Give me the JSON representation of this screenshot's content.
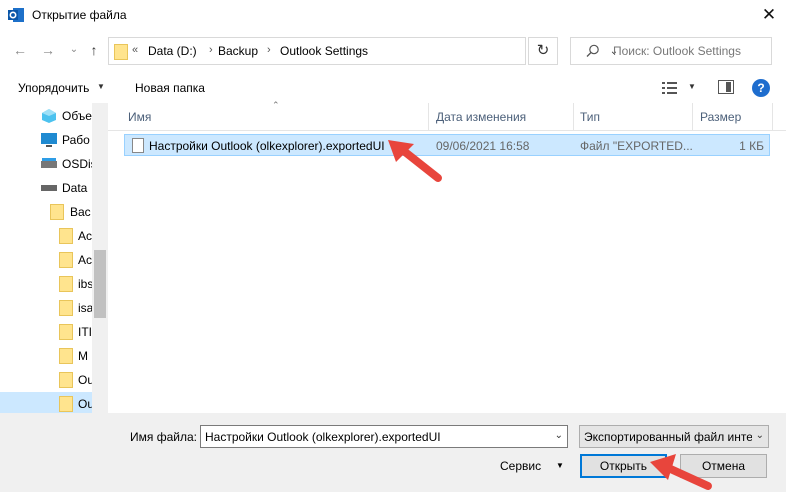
{
  "window": {
    "title": "Открытие файла",
    "close_glyph": "✕"
  },
  "nav": {
    "back_glyph": "←",
    "forward_glyph": "→",
    "history_glyph": "⌄",
    "up_glyph": "↑",
    "chevrons": "«",
    "breadcrumb": [
      "Data (D:)",
      "Backup",
      "Outlook Settings"
    ],
    "separator": "›",
    "refresh_glyph": "↻",
    "search_placeholder": "Поиск: Outlook Settings"
  },
  "toolbar": {
    "organize_label": "Упорядочить",
    "new_folder_label": "Новая папка",
    "help_glyph": "?"
  },
  "sidebar": {
    "items": [
      {
        "label": "Объе",
        "icon": "3d-objects-icon"
      },
      {
        "label": "Рабо",
        "icon": "desktop-icon"
      },
      {
        "label": "OSDis",
        "icon": "drive-icon"
      },
      {
        "label": "Data",
        "icon": "drive-icon"
      },
      {
        "label": "Bac",
        "icon": "folder-icon"
      },
      {
        "label": "Ac",
        "icon": "folder-icon"
      },
      {
        "label": "Ac",
        "icon": "folder-icon"
      },
      {
        "label": "ibs",
        "icon": "folder-icon"
      },
      {
        "label": "isa",
        "icon": "folder-icon"
      },
      {
        "label": "ITI",
        "icon": "folder-icon"
      },
      {
        "label": "M",
        "icon": "folder-icon"
      },
      {
        "label": "Ou",
        "icon": "folder-icon"
      },
      {
        "label": "Ou",
        "icon": "folder-icon",
        "selected": true
      }
    ]
  },
  "columns": {
    "name": "Имя",
    "date": "Дата изменения",
    "type": "Тип",
    "size": "Размер"
  },
  "files": [
    {
      "name": "Настройки Outlook (olkexplorer).exportedUI",
      "date": "09/06/2021 16:58",
      "type": "Файл \"EXPORTED...",
      "size": "1 КБ"
    }
  ],
  "footer": {
    "filename_label": "Имя файла:",
    "filename_value": "Настройки Outlook (olkexplorer).exportedUI",
    "filter_value": "Экспортированный файл инте",
    "dropdown_glyph": "⌄",
    "service_label": "Сервис",
    "open_label": "Открыть",
    "cancel_label": "Отмена"
  },
  "colors": {
    "selection": "#cce8ff",
    "accent": "#0078d7",
    "annotation_arrow": "#e8453c"
  }
}
